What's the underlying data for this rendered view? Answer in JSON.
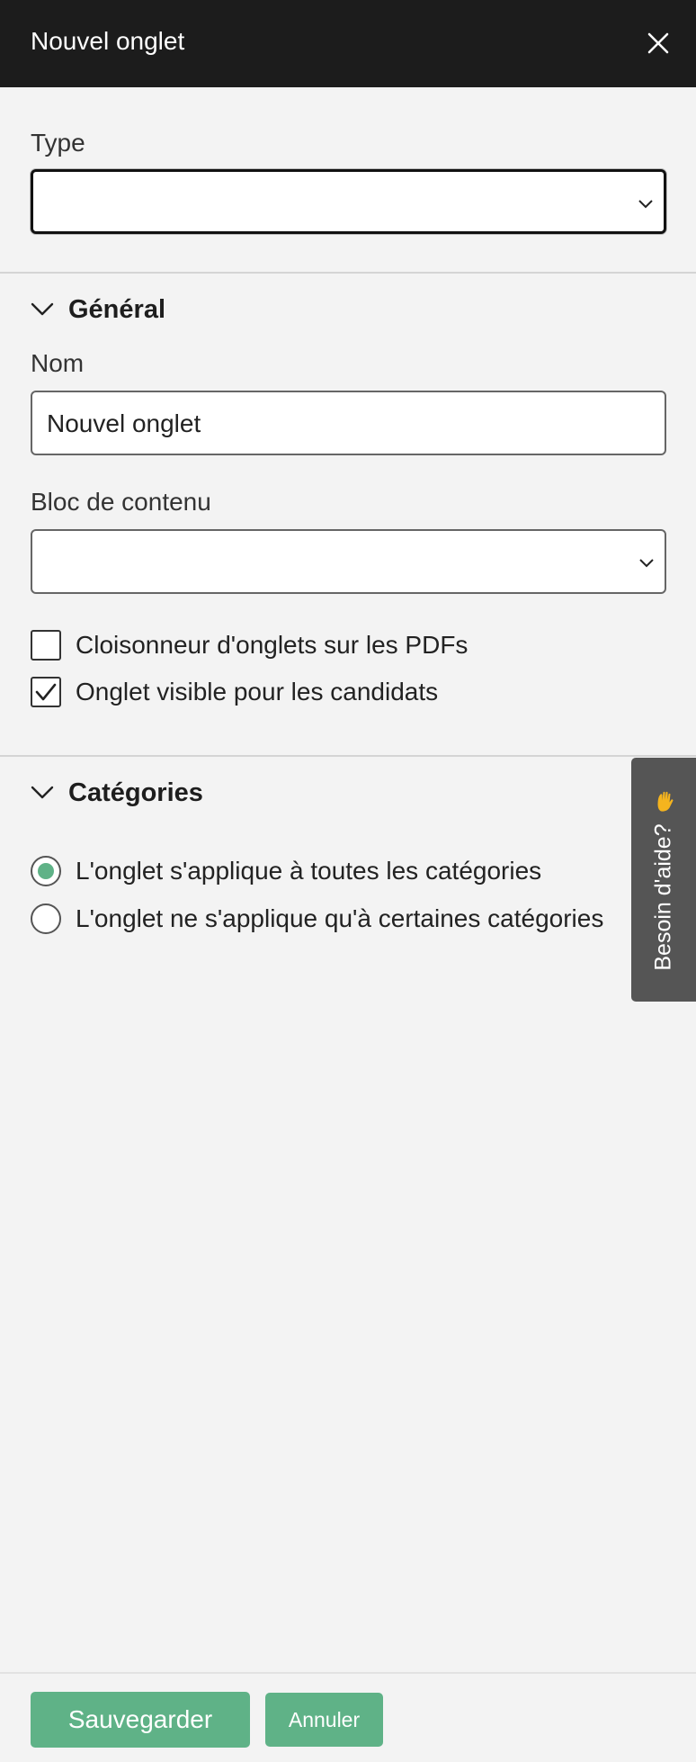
{
  "header": {
    "title": "Nouvel onglet",
    "close_icon": "close-icon"
  },
  "type_field": {
    "label": "Type",
    "value": ""
  },
  "general_section": {
    "title": "Général",
    "nom_label": "Nom",
    "nom_value": "Nouvel onglet",
    "bloc_label": "Bloc de contenu",
    "bloc_value": "",
    "checkbox_pdf": {
      "label": "Cloisonneur d'onglets sur les PDFs",
      "checked": false
    },
    "checkbox_visible": {
      "label": "Onglet visible pour les candidats",
      "checked": true
    }
  },
  "categories_section": {
    "title": "Catégories",
    "radio_all": {
      "label": "L'onglet s'applique à toutes les catégories",
      "selected": true
    },
    "radio_some": {
      "label": "L'onglet ne s'applique qu'à certaines catégories",
      "selected": false
    }
  },
  "help_tab": {
    "label": "Besoin d'aide?",
    "icon": "waving-hand-icon"
  },
  "footer": {
    "save_label": "Sauvegarder",
    "cancel_label": "Annuler"
  },
  "colors": {
    "header_bg": "#1c1c1c",
    "accent_green": "#5fb287",
    "page_bg": "#f3f3f3",
    "help_tab_bg": "#555555",
    "help_icon": "#f5b41e"
  }
}
